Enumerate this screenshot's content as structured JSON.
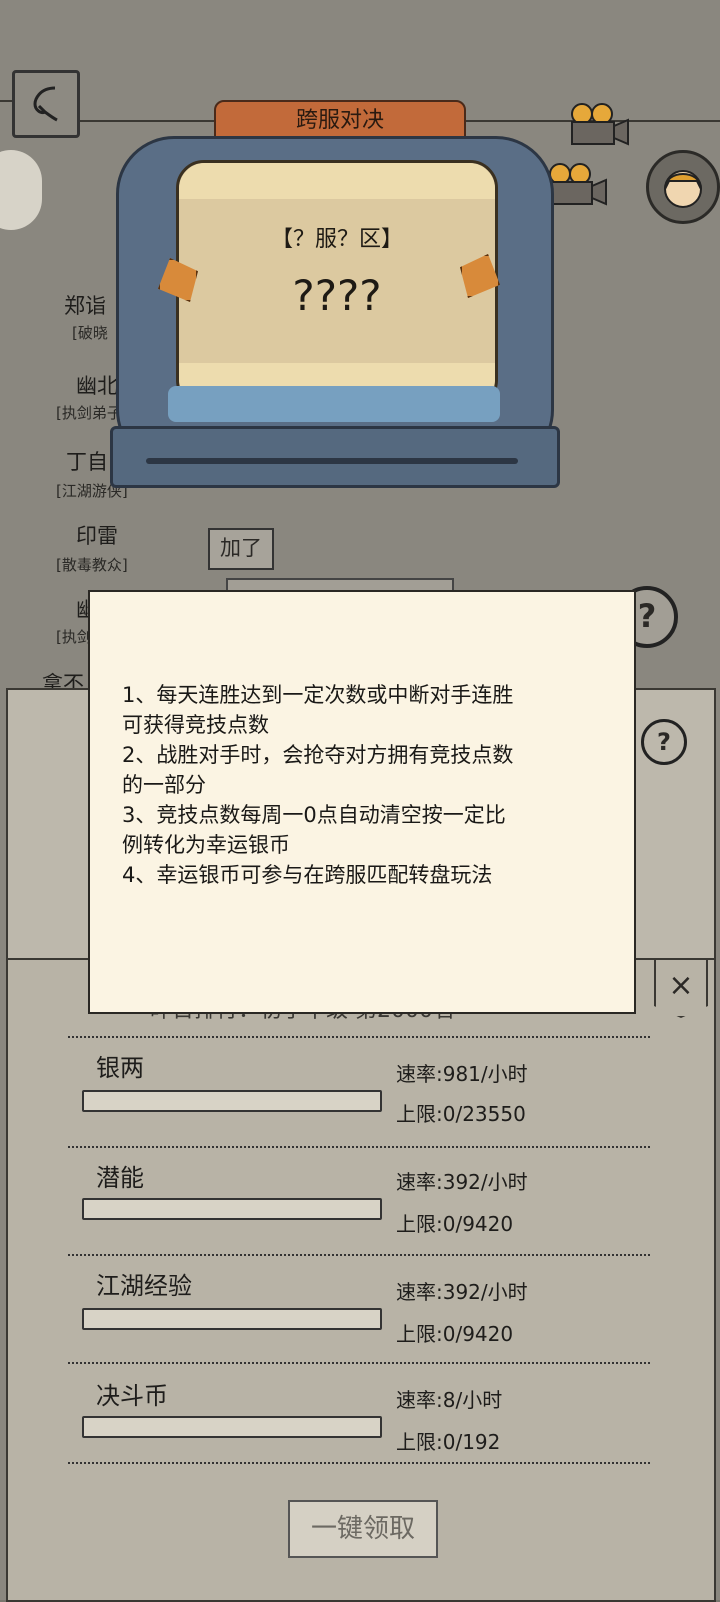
{
  "machine": {
    "title": "跨服对决",
    "server": "【？服？区】",
    "opponent_name": "????"
  },
  "background": {
    "players": [
      {
        "name": "郑诣",
        "rank": "[破晓"
      },
      {
        "name": "幽北",
        "rank": "[执剑弟子]"
      },
      {
        "name": "丁自",
        "rank": "[江湖游侠]"
      },
      {
        "name": "印雷",
        "rank": "[散毒教众]"
      },
      {
        "name": "幽",
        "rank": "[执剑"
      }
    ],
    "bubble_text": "加了",
    "partial_label": "拿不"
  },
  "dialog": {
    "rules": [
      "1、每天连胜达到一定次数或中断对手连胜",
      "可获得竞技点数",
      "2、战胜对手时，会抢夺对方拥有竞技点数",
      "的一部分",
      "3、竞技点数每周一0点自动清空按一定比",
      "例转化为幸运银币",
      "4、幸运银币可参与在跨服匹配转盘玩法"
    ]
  },
  "rewards": {
    "rank_text": "昨日排行：初子中级 第2000名",
    "items": [
      {
        "name": "银两",
        "rate": "速率:981/小时",
        "limit": "上限:0/23550",
        "progress": 0
      },
      {
        "name": "潜能",
        "rate": "速率:392/小时",
        "limit": "上限:0/9420",
        "progress": 0
      },
      {
        "name": "江湖经验",
        "rate": "速率:392/小时",
        "limit": "上限:0/9420",
        "progress": 0
      },
      {
        "name": "决斗币",
        "rate": "速率:8/小时",
        "limit": "上限:0/192",
        "progress": 0
      }
    ],
    "claim_label": "一键领取",
    "close_icon": "×"
  },
  "icons": {
    "back": "back-icon",
    "help": "question-icon",
    "camera": "video-camera-icon",
    "avatar": "avatar-icon"
  }
}
